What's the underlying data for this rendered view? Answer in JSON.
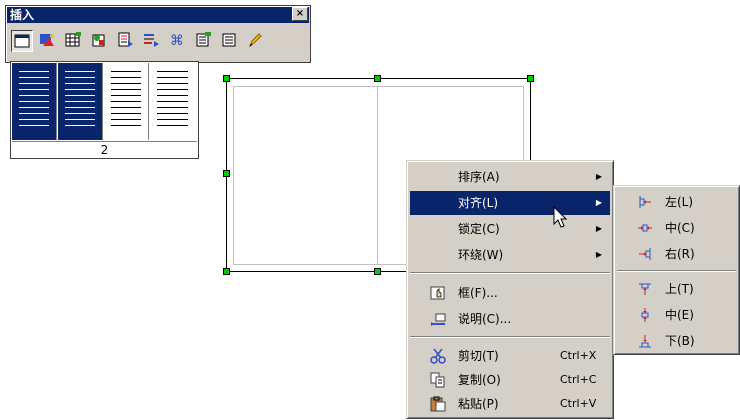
{
  "toolbar": {
    "title": "插入",
    "close_label": "×",
    "icons": [
      "frame-icon",
      "image-icon",
      "table-icon",
      "gallery-icon",
      "insert-text-icon",
      "insert-field-icon",
      "special-char-icon",
      "insert-doc-icon",
      "list-icon",
      "pen-icon"
    ]
  },
  "columns_dropdown": {
    "count": "2",
    "selected_columns": 2,
    "total_columns": 4
  },
  "context_menu": {
    "items": [
      {
        "label": "排序(A)",
        "has_submenu": true
      },
      {
        "label": "对齐(L)",
        "has_submenu": true,
        "highlighted": true
      },
      {
        "label": "锁定(C)",
        "has_submenu": true
      },
      {
        "label": "环绕(W)",
        "has_submenu": true
      },
      {
        "label": "框(F)...",
        "icon": "frame-properties-icon"
      },
      {
        "label": "说明(C)...",
        "icon": "caption-icon"
      },
      {
        "label": "剪切(T)",
        "shortcut": "Ctrl+X",
        "icon": "scissors-icon"
      },
      {
        "label": "复制(O)",
        "shortcut": "Ctrl+C",
        "icon": "copy-icon"
      },
      {
        "label": "粘贴(P)",
        "shortcut": "Ctrl+V",
        "icon": "paste-icon"
      }
    ]
  },
  "align_submenu": {
    "items": [
      {
        "label": "左(L)",
        "icon": "align-left-icon"
      },
      {
        "label": "中(C)",
        "icon": "align-center-icon"
      },
      {
        "label": "右(R)",
        "icon": "align-right-icon"
      },
      {
        "label": "上(T)",
        "icon": "align-top-icon"
      },
      {
        "label": "中(E)",
        "icon": "align-middle-icon"
      },
      {
        "label": "下(B)",
        "icon": "align-bottom-icon"
      }
    ]
  },
  "colors": {
    "highlight": "#0a246a",
    "menu_bg": "#d4d0c8",
    "handle": "#00cc00"
  }
}
